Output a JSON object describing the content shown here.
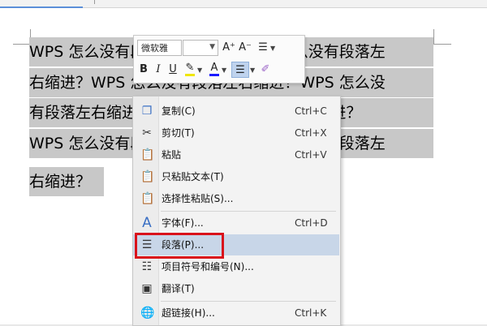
{
  "document": {
    "lines": [
      "WPS 怎么没有段落左右缩进？WPS 怎么没有段落左",
      "右缩进？WPS 怎么没有段落左右缩进？WPS 怎么没",
      "有段落左右缩进？WPS 怎么没有段落左右缩进？",
      "WPS 怎么没有段落左右缩进？WPS 怎么没有段落左",
      "右缩进？"
    ]
  },
  "mini_toolbar": {
    "font_name": "微软雅",
    "grow_font": "A⁺",
    "shrink_font": "A⁻",
    "bold": "B",
    "italic": "I",
    "underline": "U",
    "font_color": "A"
  },
  "context_menu": {
    "items": [
      {
        "label": "复制(C)",
        "shortcut": "Ctrl+C"
      },
      {
        "label": "剪切(T)",
        "shortcut": "Ctrl+X"
      },
      {
        "label": "粘贴",
        "shortcut": "Ctrl+V"
      },
      {
        "label": "只粘贴文本(T)",
        "shortcut": ""
      },
      {
        "label": "选择性粘贴(S)...",
        "shortcut": ""
      },
      {
        "label": "字体(F)...",
        "shortcut": "Ctrl+D"
      },
      {
        "label": "段落(P)...",
        "shortcut": ""
      },
      {
        "label": "项目符号和编号(N)...",
        "shortcut": ""
      },
      {
        "label": "翻译(T)",
        "shortcut": ""
      },
      {
        "label": "超链接(H)...",
        "shortcut": "Ctrl+K"
      }
    ],
    "highlighted_item": "段落(P)..."
  },
  "colors": {
    "selection": "#c8c8c8",
    "menu_highlight": "#c8d6e8",
    "annotation_box": "#d9121b",
    "font_color_bar": "#1a1aff",
    "highlighter_bar": "#f0e600"
  }
}
